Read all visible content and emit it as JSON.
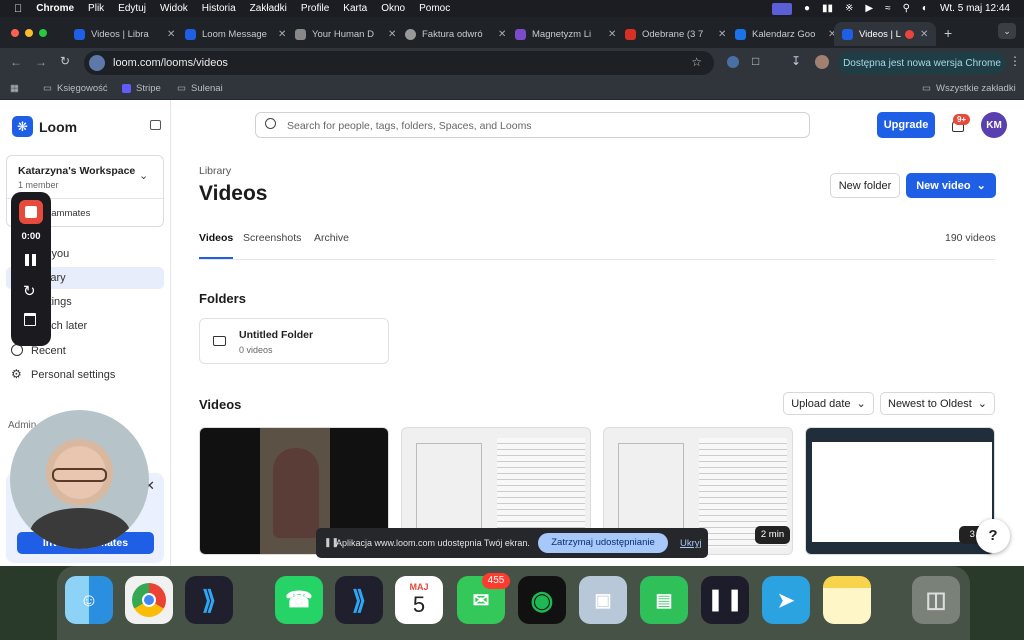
{
  "menubar": {
    "items": [
      "Chrome",
      "Plik",
      "Edytuj",
      "Widok",
      "Historia",
      "Zakładki",
      "Profile",
      "Karta",
      "Okno",
      "Pomoc"
    ],
    "datetime": "Wt. 5 maj  12:44"
  },
  "tabs": [
    {
      "title": "Videos | Libra",
      "color": "#1e5fe6"
    },
    {
      "title": "Loom Message",
      "color": "#1e5fe6"
    },
    {
      "title": "Your Human D",
      "color": "#888888"
    },
    {
      "title": "Faktura odwró",
      "color": "#999999"
    },
    {
      "title": "Magnetyzm Li",
      "color": "#7b4bc9"
    },
    {
      "title": "Odebrane (3 7",
      "color": "#d93025"
    },
    {
      "title": "Kalendarz Goo",
      "color": "#1a73e8"
    },
    {
      "title": "Videos | Li",
      "color": "#1e5fe6"
    }
  ],
  "toolbar": {
    "url": "loom.com/looms/videos",
    "update_label": "Dostępna jest nowa wersja Chrome"
  },
  "bookmarks": {
    "items": [
      "Księgowość",
      "Stripe",
      "Sulenai"
    ],
    "all": "Wszystkie zakładki"
  },
  "sidebar": {
    "brand": "Loom",
    "workspace_name": "Katarzyna's Workspace",
    "workspace_members": "1 member",
    "invite_label": "Invite teammates",
    "nav": [
      "For you",
      "Library",
      "Settings",
      "Watch later",
      "Recent",
      "Personal settings"
    ],
    "admin_label": "Admin",
    "invite_button": "Invite teammates"
  },
  "recorder": {
    "timer": "0:00"
  },
  "header": {
    "search_placeholder": "Search for people, tags, folders, Spaces, and Looms",
    "upgrade": "Upgrade",
    "notifications": "9+",
    "avatar": "KM"
  },
  "library": {
    "breadcrumb": "Library",
    "title": "Videos",
    "new_folder": "New folder",
    "new_video": "New video",
    "tabs": [
      "Videos",
      "Screenshots",
      "Archive"
    ],
    "count": "190 videos",
    "folders_heading": "Folders",
    "folder_name": "Untitled Folder",
    "folder_count": "0 videos",
    "videos_heading": "Videos",
    "sort1": "Upload date",
    "sort2": "Newest to Oldest",
    "durations": [
      "2 min",
      "3 s"
    ]
  },
  "sharebar": {
    "text": "Aplikacja www.loom.com udostępnia Twój ekran.",
    "stop": "Zatrzymaj udostępnianie",
    "hide": "Ukryj"
  },
  "help": "?",
  "dock": {
    "calendar_month": "MAJ",
    "calendar_day": "5",
    "messages_badge": "455"
  }
}
